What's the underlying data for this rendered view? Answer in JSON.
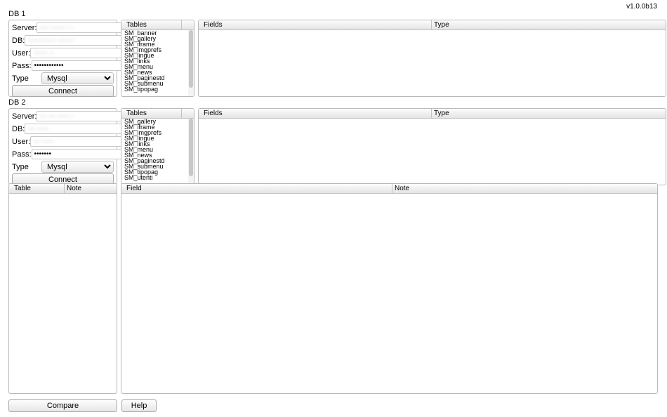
{
  "version": "v1.0.0b13",
  "db1": {
    "title": "DB 1",
    "labels": {
      "server": "Server:",
      "db": "DB:",
      "user": "User:",
      "pass": "Pass:",
      "type": "Type"
    },
    "values": {
      "server": "···· ······ · ·",
      "db": "············ ·······",
      "user": "······ ··",
      "pass": "••••••••••••",
      "type": "Mysql"
    },
    "connect": "Connect",
    "tables_header": "Tables",
    "tables": [
      "SM_banner",
      "SM_gallery",
      "SM_iframe",
      "SM_imgprefs",
      "SM_lingue",
      "SM_links",
      "SM_menu",
      "SM_news",
      "SM_paginestd",
      "SM_submenu",
      "SM_tipopag"
    ],
    "fields_headers": {
      "fields": "Fields",
      "type": "Type"
    }
  },
  "db2": {
    "title": "DB 2",
    "labels": {
      "server": "Server:",
      "db": "DB:",
      "user": "User:",
      "pass": "Pass:",
      "type": "Type"
    },
    "values": {
      "server": "··· ··· ····· ·",
      "db": "··· ·····",
      "user": "··· ·····",
      "pass": "•••••••",
      "type": "Mysql"
    },
    "connect": "Connect",
    "tables_header": "Tables",
    "tables": [
      "SM_gallery",
      "SM_iframe",
      "SM_imgprefs",
      "SM_lingue",
      "SM_links",
      "SM_menu",
      "SM_news",
      "SM_paginestd",
      "SM_submenu",
      "SM_tipopag",
      "SM_utenti"
    ],
    "fields_headers": {
      "fields": "Fields",
      "type": "Type"
    }
  },
  "bottom_left_headers": {
    "table": "Table",
    "note": "Note"
  },
  "bottom_right_headers": {
    "field": "Field",
    "note": "Note"
  },
  "buttons": {
    "compare": "Compare",
    "help": "Help"
  }
}
